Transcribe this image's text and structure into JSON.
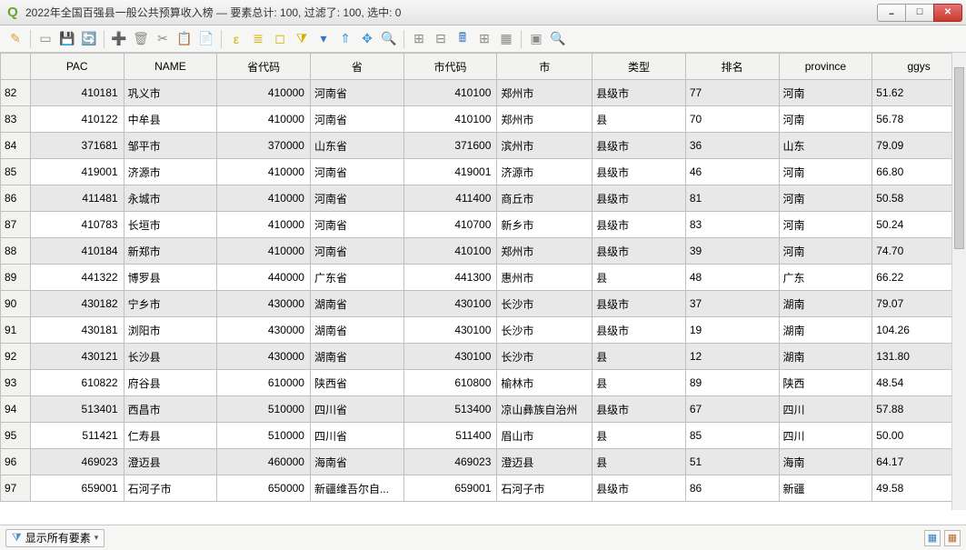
{
  "window": {
    "title": "2022年全国百强县一般公共预算收入榜 — 要素总计: 100, 过滤了: 100, 选中: 0"
  },
  "toolbar_icons": [
    {
      "name": "pencil-icon",
      "glyph": "✎",
      "color": "#d8a030"
    },
    {
      "name": "sep"
    },
    {
      "name": "new-icon",
      "glyph": "▭",
      "color": "#8a8a8a"
    },
    {
      "name": "save-icon",
      "glyph": "💾",
      "color": "#8a8a8a"
    },
    {
      "name": "refresh-icon",
      "glyph": "🔄",
      "color": "#2e77c0"
    },
    {
      "name": "sep"
    },
    {
      "name": "add-feature-icon",
      "glyph": "➕",
      "color": "#8a8a8a"
    },
    {
      "name": "delete-icon",
      "glyph": "🗑",
      "color": "#8a8a8a"
    },
    {
      "name": "cut-icon",
      "glyph": "✂",
      "color": "#8a8a8a"
    },
    {
      "name": "copy-icon",
      "glyph": "📋",
      "color": "#8a8a8a"
    },
    {
      "name": "paste-icon",
      "glyph": "📄",
      "color": "#8a8a8a"
    },
    {
      "name": "sep"
    },
    {
      "name": "select-expr-icon",
      "glyph": "ε",
      "color": "#d6b100"
    },
    {
      "name": "select-all-icon",
      "glyph": "≣",
      "color": "#d6b100"
    },
    {
      "name": "deselect-icon",
      "glyph": "◻",
      "color": "#d6b100"
    },
    {
      "name": "filter-select-icon",
      "glyph": "⧩",
      "color": "#d6b100"
    },
    {
      "name": "filter-icon",
      "glyph": "▾",
      "color": "#2e77c0"
    },
    {
      "name": "move-top-icon",
      "glyph": "⇑",
      "color": "#3a99d8"
    },
    {
      "name": "pan-selected-icon",
      "glyph": "✥",
      "color": "#3a99d8"
    },
    {
      "name": "zoom-selected-icon",
      "glyph": "🔍",
      "color": "#3a99d8"
    },
    {
      "name": "sep"
    },
    {
      "name": "new-field-icon",
      "glyph": "⊞",
      "color": "#8a8a8a"
    },
    {
      "name": "delete-field-icon",
      "glyph": "⊟",
      "color": "#8a8a8a"
    },
    {
      "name": "field-calc-icon",
      "glyph": "🖩",
      "color": "#3a7abd"
    },
    {
      "name": "organize-icon",
      "glyph": "⊞",
      "color": "#8a8a8a"
    },
    {
      "name": "conditional-icon",
      "glyph": "▦",
      "color": "#8a8a8a"
    },
    {
      "name": "sep"
    },
    {
      "name": "dock-icon",
      "glyph": "▣",
      "color": "#8a8a8a"
    },
    {
      "name": "actions-icon",
      "glyph": "🔍",
      "color": "#3a99d8"
    }
  ],
  "columns": [
    "PAC",
    "NAME",
    "省代码",
    "省",
    "市代码",
    "市",
    "类型",
    "排名",
    "province",
    "ggys"
  ],
  "rows": [
    {
      "n": "82",
      "pac": "410181",
      "name": "巩义市",
      "pcode": "410000",
      "prov": "河南省",
      "ccode": "410100",
      "city": "郑州市",
      "type": "县级市",
      "rank": "77",
      "province": "河南",
      "ggys": "51.62"
    },
    {
      "n": "83",
      "pac": "410122",
      "name": "中牟县",
      "pcode": "410000",
      "prov": "河南省",
      "ccode": "410100",
      "city": "郑州市",
      "type": "县",
      "rank": "70",
      "province": "河南",
      "ggys": "56.78"
    },
    {
      "n": "84",
      "pac": "371681",
      "name": "邹平市",
      "pcode": "370000",
      "prov": "山东省",
      "ccode": "371600",
      "city": "滨州市",
      "type": "县级市",
      "rank": "36",
      "province": "山东",
      "ggys": "79.09"
    },
    {
      "n": "85",
      "pac": "419001",
      "name": "济源市",
      "pcode": "410000",
      "prov": "河南省",
      "ccode": "419001",
      "city": "济源市",
      "type": "县级市",
      "rank": "46",
      "province": "河南",
      "ggys": "66.80"
    },
    {
      "n": "86",
      "pac": "411481",
      "name": "永城市",
      "pcode": "410000",
      "prov": "河南省",
      "ccode": "411400",
      "city": "商丘市",
      "type": "县级市",
      "rank": "81",
      "province": "河南",
      "ggys": "50.58"
    },
    {
      "n": "87",
      "pac": "410783",
      "name": "长垣市",
      "pcode": "410000",
      "prov": "河南省",
      "ccode": "410700",
      "city": "新乡市",
      "type": "县级市",
      "rank": "83",
      "province": "河南",
      "ggys": "50.24"
    },
    {
      "n": "88",
      "pac": "410184",
      "name": "新郑市",
      "pcode": "410000",
      "prov": "河南省",
      "ccode": "410100",
      "city": "郑州市",
      "type": "县级市",
      "rank": "39",
      "province": "河南",
      "ggys": "74.70"
    },
    {
      "n": "89",
      "pac": "441322",
      "name": "博罗县",
      "pcode": "440000",
      "prov": "广东省",
      "ccode": "441300",
      "city": "惠州市",
      "type": "县",
      "rank": "48",
      "province": "广东",
      "ggys": "66.22"
    },
    {
      "n": "90",
      "pac": "430182",
      "name": "宁乡市",
      "pcode": "430000",
      "prov": "湖南省",
      "ccode": "430100",
      "city": "长沙市",
      "type": "县级市",
      "rank": "37",
      "province": "湖南",
      "ggys": "79.07"
    },
    {
      "n": "91",
      "pac": "430181",
      "name": "浏阳市",
      "pcode": "430000",
      "prov": "湖南省",
      "ccode": "430100",
      "city": "长沙市",
      "type": "县级市",
      "rank": "19",
      "province": "湖南",
      "ggys": "104.26"
    },
    {
      "n": "92",
      "pac": "430121",
      "name": "长沙县",
      "pcode": "430000",
      "prov": "湖南省",
      "ccode": "430100",
      "city": "长沙市",
      "type": "县",
      "rank": "12",
      "province": "湖南",
      "ggys": "131.80"
    },
    {
      "n": "93",
      "pac": "610822",
      "name": "府谷县",
      "pcode": "610000",
      "prov": "陕西省",
      "ccode": "610800",
      "city": "榆林市",
      "type": "县",
      "rank": "89",
      "province": "陕西",
      "ggys": "48.54"
    },
    {
      "n": "94",
      "pac": "513401",
      "name": "西昌市",
      "pcode": "510000",
      "prov": "四川省",
      "ccode": "513400",
      "city": "凉山彝族自治州",
      "type": "县级市",
      "rank": "67",
      "province": "四川",
      "ggys": "57.88"
    },
    {
      "n": "95",
      "pac": "511421",
      "name": "仁寿县",
      "pcode": "510000",
      "prov": "四川省",
      "ccode": "511400",
      "city": "眉山市",
      "type": "县",
      "rank": "85",
      "province": "四川",
      "ggys": "50.00"
    },
    {
      "n": "96",
      "pac": "469023",
      "name": "澄迈县",
      "pcode": "460000",
      "prov": "海南省",
      "ccode": "469023",
      "city": "澄迈县",
      "type": "县",
      "rank": "51",
      "province": "海南",
      "ggys": "64.17"
    },
    {
      "n": "97",
      "pac": "659001",
      "name": "石河子市",
      "pcode": "650000",
      "prov": "新疆维吾尔自...",
      "ccode": "659001",
      "city": "石河子市",
      "type": "县级市",
      "rank": "86",
      "province": "新疆",
      "ggys": "49.58"
    }
  ],
  "bottom": {
    "filter_label": "显示所有要素"
  }
}
